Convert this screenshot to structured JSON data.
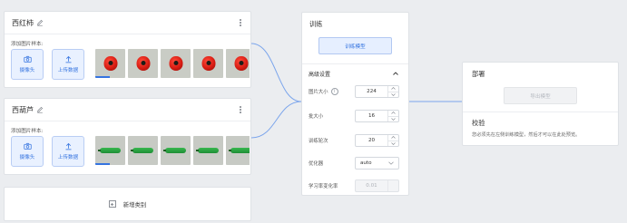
{
  "classes": [
    {
      "name": "西红柿",
      "sample_hint": "添加图片样本:",
      "camera_label": "摄像头",
      "upload_label": "上传数据",
      "thumbnail_kind": "tomato"
    },
    {
      "name": "西葫芦",
      "sample_hint": "添加图片样本:",
      "camera_label": "摄像头",
      "upload_label": "上传数据",
      "thumbnail_kind": "cucumber"
    }
  ],
  "add_class": {
    "label": "新增类别"
  },
  "training": {
    "title": "训练",
    "train_button": "训练模型",
    "advanced_title": "高级设置",
    "params": {
      "image_size": {
        "label": "图片大小",
        "value": "224"
      },
      "batch_size": {
        "label": "批大小",
        "value": "16"
      },
      "epochs": {
        "label": "训练轮次",
        "value": "20"
      },
      "optimizer": {
        "label": "优化器",
        "value": "auto"
      },
      "lr_change": {
        "label": "学习率变化率",
        "value": "0.01"
      }
    }
  },
  "deploy": {
    "title": "部署",
    "export_button": "导出模型",
    "validate_title": "校验",
    "validate_message": "您必须先在左侧训练模型，然后才可以在此处预览。"
  },
  "colors": {
    "accent": "#3574e0",
    "connector": "#7ba5ec",
    "background": "#ebedf0"
  }
}
